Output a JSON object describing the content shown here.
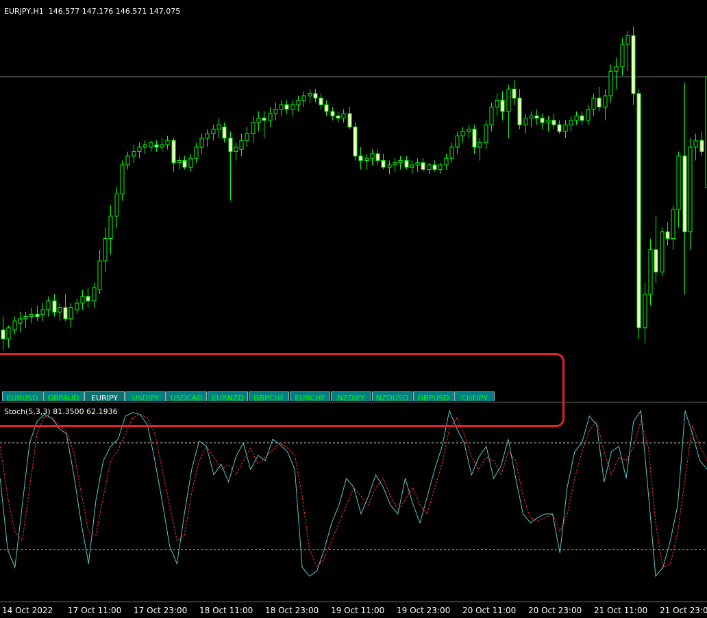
{
  "main": {
    "symbol": "EURJPY,H1",
    "ohlc": "146.577 147.176 146.571 147.075",
    "price_line": 147.075,
    "y_range": [
      145.75,
      147.3
    ],
    "bull_color": "#00ff00",
    "bear_color": "#ffffcc",
    "candles": [
      [
        145.94,
        146.0,
        145.85,
        145.9
      ],
      [
        145.9,
        145.96,
        145.86,
        145.95
      ],
      [
        145.94,
        146.0,
        145.92,
        145.98
      ],
      [
        145.97,
        146.02,
        145.93,
        145.99
      ],
      [
        145.99,
        146.02,
        145.95,
        146.0
      ],
      [
        146.0,
        146.04,
        145.97,
        146.01
      ],
      [
        146.01,
        146.05,
        145.98,
        146.0
      ],
      [
        146.01,
        146.06,
        145.98,
        146.03
      ],
      [
        146.03,
        146.09,
        146.0,
        146.07
      ],
      [
        146.07,
        146.1,
        146.0,
        146.02
      ],
      [
        146.02,
        146.06,
        145.98,
        146.04
      ],
      [
        146.04,
        146.1,
        145.98,
        145.99
      ],
      [
        145.99,
        146.06,
        145.95,
        146.04
      ],
      [
        146.03,
        146.08,
        146.01,
        146.06
      ],
      [
        146.06,
        146.12,
        146.03,
        146.09
      ],
      [
        146.09,
        146.13,
        146.04,
        146.07
      ],
      [
        146.07,
        146.15,
        146.04,
        146.13
      ],
      [
        146.12,
        146.3,
        146.1,
        146.25
      ],
      [
        146.25,
        146.4,
        146.2,
        146.35
      ],
      [
        146.35,
        146.5,
        146.28,
        146.45
      ],
      [
        146.45,
        146.58,
        146.4,
        146.55
      ],
      [
        146.55,
        146.7,
        146.52,
        146.68
      ],
      [
        146.68,
        146.74,
        146.66,
        146.72
      ],
      [
        146.72,
        146.77,
        146.69,
        146.74
      ],
      [
        146.74,
        146.78,
        146.71,
        146.76
      ],
      [
        146.76,
        146.79,
        146.73,
        146.77
      ],
      [
        146.76,
        146.79,
        146.74,
        146.78
      ],
      [
        146.77,
        146.79,
        146.74,
        146.76
      ],
      [
        146.76,
        146.8,
        146.74,
        146.77
      ],
      [
        146.77,
        146.81,
        146.75,
        146.79
      ],
      [
        146.79,
        146.8,
        146.65,
        146.69
      ],
      [
        146.69,
        146.72,
        146.66,
        146.7
      ],
      [
        146.7,
        146.72,
        146.66,
        146.67
      ],
      [
        146.67,
        146.73,
        146.65,
        146.71
      ],
      [
        146.71,
        146.78,
        146.69,
        146.76
      ],
      [
        146.76,
        146.82,
        146.73,
        146.8
      ],
      [
        146.8,
        146.84,
        146.76,
        146.82
      ],
      [
        146.82,
        146.86,
        146.79,
        146.84
      ],
      [
        146.84,
        146.89,
        146.8,
        146.86
      ],
      [
        146.85,
        146.87,
        146.78,
        146.8
      ],
      [
        146.8,
        146.83,
        146.52,
        146.74
      ],
      [
        146.74,
        146.78,
        146.7,
        146.76
      ],
      [
        146.75,
        146.82,
        146.72,
        146.79
      ],
      [
        146.79,
        146.85,
        146.76,
        146.82
      ],
      [
        146.82,
        146.9,
        146.78,
        146.87
      ],
      [
        146.87,
        146.92,
        146.83,
        146.89
      ],
      [
        146.89,
        146.92,
        146.8,
        146.88
      ],
      [
        146.88,
        146.94,
        146.85,
        146.91
      ],
      [
        146.91,
        146.96,
        146.88,
        146.93
      ],
      [
        146.93,
        146.97,
        146.9,
        146.95
      ],
      [
        146.95,
        146.97,
        146.91,
        146.93
      ],
      [
        146.93,
        146.97,
        146.9,
        146.95
      ],
      [
        146.95,
        146.99,
        146.92,
        146.97
      ],
      [
        146.97,
        147.01,
        146.94,
        146.99
      ],
      [
        146.99,
        147.02,
        146.96,
        147.0
      ],
      [
        147.0,
        147.02,
        146.96,
        146.98
      ],
      [
        146.98,
        147.0,
        146.93,
        146.95
      ],
      [
        146.95,
        146.97,
        146.9,
        146.92
      ],
      [
        146.92,
        146.94,
        146.88,
        146.9
      ],
      [
        146.9,
        146.92,
        146.87,
        146.89
      ],
      [
        146.89,
        146.93,
        146.87,
        146.91
      ],
      [
        146.91,
        146.94,
        146.84,
        146.85
      ],
      [
        146.85,
        146.87,
        146.7,
        146.72
      ],
      [
        146.72,
        146.76,
        146.66,
        146.7
      ],
      [
        146.7,
        146.73,
        146.66,
        146.71
      ],
      [
        146.71,
        146.75,
        146.68,
        146.73
      ],
      [
        146.73,
        146.75,
        146.68,
        146.7
      ],
      [
        146.7,
        146.73,
        146.66,
        146.67
      ],
      [
        146.67,
        146.7,
        146.64,
        146.68
      ],
      [
        146.68,
        146.71,
        146.65,
        146.69
      ],
      [
        146.69,
        146.72,
        146.66,
        146.7
      ],
      [
        146.7,
        146.72,
        146.66,
        146.67
      ],
      [
        146.67,
        146.7,
        146.64,
        146.68
      ],
      [
        146.68,
        146.71,
        146.65,
        146.69
      ],
      [
        146.69,
        146.71,
        146.65,
        146.66
      ],
      [
        146.66,
        146.69,
        146.64,
        146.68
      ],
      [
        146.68,
        146.7,
        146.65,
        146.66
      ],
      [
        146.66,
        146.69,
        146.64,
        146.68
      ],
      [
        146.68,
        146.73,
        146.66,
        146.71
      ],
      [
        146.71,
        146.78,
        146.69,
        146.76
      ],
      [
        146.76,
        146.83,
        146.73,
        146.81
      ],
      [
        146.81,
        146.85,
        146.78,
        146.83
      ],
      [
        146.83,
        146.86,
        146.8,
        146.84
      ],
      [
        146.84,
        146.86,
        146.73,
        146.76
      ],
      [
        146.76,
        146.8,
        146.7,
        146.78
      ],
      [
        146.78,
        146.88,
        146.75,
        146.86
      ],
      [
        146.86,
        146.96,
        146.83,
        146.94
      ],
      [
        146.94,
        147.0,
        146.9,
        146.97
      ],
      [
        146.97,
        147.01,
        146.88,
        146.92
      ],
      [
        146.92,
        147.04,
        146.8,
        147.02
      ],
      [
        147.02,
        147.06,
        146.95,
        146.98
      ],
      [
        146.98,
        147.02,
        146.84,
        146.86
      ],
      [
        146.86,
        146.91,
        146.82,
        146.89
      ],
      [
        146.89,
        146.92,
        146.85,
        146.9
      ],
      [
        146.9,
        146.93,
        146.86,
        146.89
      ],
      [
        146.89,
        146.91,
        146.84,
        146.87
      ],
      [
        146.87,
        146.9,
        146.83,
        146.88
      ],
      [
        146.88,
        146.91,
        146.84,
        146.86
      ],
      [
        146.86,
        146.88,
        146.82,
        146.83
      ],
      [
        146.83,
        146.88,
        146.8,
        146.86
      ],
      [
        146.86,
        146.9,
        146.83,
        146.88
      ],
      [
        146.88,
        146.92,
        146.86,
        146.9
      ],
      [
        146.9,
        146.92,
        146.86,
        146.88
      ],
      [
        146.88,
        146.95,
        146.86,
        146.93
      ],
      [
        146.93,
        147.0,
        146.9,
        146.98
      ],
      [
        146.98,
        147.03,
        146.92,
        146.94
      ],
      [
        146.94,
        147.02,
        146.88,
        146.99
      ],
      [
        146.99,
        147.13,
        146.96,
        147.1
      ],
      [
        147.1,
        147.16,
        147.02,
        147.12
      ],
      [
        147.12,
        147.25,
        147.08,
        147.22
      ],
      [
        147.22,
        147.28,
        147.1,
        147.26
      ],
      [
        147.26,
        147.3,
        146.95,
        147.0
      ],
      [
        147.0,
        147.02,
        145.9,
        145.95
      ],
      [
        145.95,
        146.15,
        145.88,
        146.1
      ],
      [
        146.1,
        146.35,
        146.05,
        146.3
      ],
      [
        146.3,
        146.45,
        146.15,
        146.2
      ],
      [
        146.2,
        146.4,
        146.18,
        146.38
      ],
      [
        146.38,
        146.42,
        146.32,
        146.35
      ],
      [
        146.35,
        146.5,
        146.3,
        146.48
      ],
      [
        146.48,
        146.74,
        146.4,
        146.72
      ],
      [
        146.72,
        147.05,
        146.1,
        146.38
      ],
      [
        146.38,
        146.8,
        146.3,
        146.76
      ],
      [
        146.76,
        146.82,
        146.7,
        146.79
      ],
      [
        146.79,
        146.83,
        146.72,
        146.74
      ],
      [
        146.577,
        147.176,
        146.571,
        147.075
      ]
    ]
  },
  "symbols": {
    "items": [
      "EURUSD",
      "GBPAUD",
      "EURJPY",
      "USDJPY",
      "USDCAD",
      "EURNZD",
      "GBPCHF",
      "EURCHF",
      "NZDJPY",
      "NZDUSD",
      "GBPUSD",
      "CHFJPY"
    ],
    "active": "EURJPY"
  },
  "stoch": {
    "header": "Stoch(5,3,3) 81.3500 62.1936",
    "levels": [
      80,
      20
    ],
    "main_color": "#5fc8c8",
    "signal_color": "#ff3030",
    "main": [
      60,
      20,
      10,
      45,
      80,
      92,
      96,
      94,
      88,
      85,
      62,
      35,
      12,
      48,
      70,
      78,
      82,
      95,
      97,
      96,
      90,
      70,
      47,
      22,
      12,
      40,
      65,
      81,
      78,
      62,
      68,
      58,
      72,
      80,
      65,
      73,
      70,
      82,
      79,
      75,
      65,
      10,
      5,
      8,
      20,
      35,
      45,
      60,
      55,
      40,
      50,
      62,
      55,
      45,
      40,
      60,
      46,
      35,
      50,
      65,
      78,
      98,
      88,
      80,
      62,
      72,
      78,
      60,
      67,
      82,
      60,
      40,
      35,
      38,
      40,
      40,
      18,
      55,
      75,
      80,
      95,
      90,
      58,
      75,
      78,
      60,
      92,
      98,
      52,
      5,
      10,
      25,
      45,
      98,
      85,
      70,
      65,
      75
    ],
    "signal": [
      78,
      50,
      30,
      25,
      55,
      85,
      95,
      94,
      90,
      86,
      75,
      52,
      30,
      28,
      50,
      70,
      76,
      85,
      94,
      96,
      94,
      85,
      65,
      45,
      25,
      28,
      52,
      70,
      78,
      72,
      65,
      68,
      62,
      70,
      77,
      68,
      72,
      76,
      80,
      77,
      73,
      50,
      20,
      10,
      15,
      25,
      35,
      45,
      55,
      50,
      45,
      55,
      60,
      50,
      42,
      48,
      55,
      45,
      40,
      55,
      68,
      88,
      94,
      85,
      72,
      65,
      72,
      70,
      62,
      75,
      70,
      50,
      38,
      36,
      38,
      40,
      30,
      40,
      60,
      75,
      87,
      92,
      75,
      62,
      72,
      70,
      78,
      92,
      78,
      35,
      10,
      12,
      30,
      60,
      90,
      78,
      70,
      72
    ],
    "x_start": 0.3,
    "x_step": 10.75
  },
  "time_axis": [
    "14 Oct 2022",
    "17 Oct 11:00",
    "17 Oct 23:00",
    "18 Oct 11:00",
    "18 Oct 23:00",
    "19 Oct 11:00",
    "19 Oct 23:00",
    "20 Oct 11:00",
    "20 Oct 23:00",
    "21 Oct 11:00",
    "21 Oct 23:00"
  ]
}
